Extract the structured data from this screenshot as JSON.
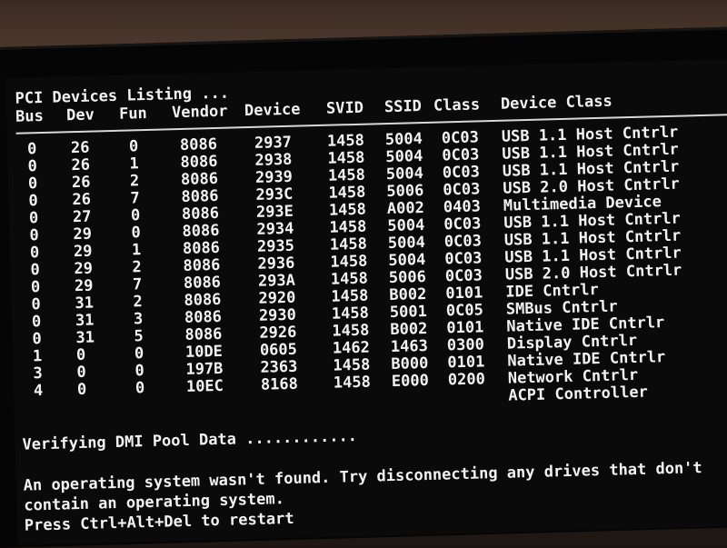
{
  "title": "PCI Devices Listing ...",
  "headers": {
    "bus": "Bus",
    "dev": "Dev",
    "fun": "Fun",
    "vendor": "Vendor",
    "device": "Device",
    "svid": "SVID",
    "ssid": "SSID",
    "class": "Class",
    "device_class": "Device Class"
  },
  "rows": [
    {
      "bus": "0",
      "dev": "26",
      "fun": "0",
      "vendor": "8086",
      "device": "2937",
      "svid": "1458",
      "ssid": "5004",
      "class": "0C03",
      "device_class": "USB 1.1 Host Cntrlr"
    },
    {
      "bus": "0",
      "dev": "26",
      "fun": "1",
      "vendor": "8086",
      "device": "2938",
      "svid": "1458",
      "ssid": "5004",
      "class": "0C03",
      "device_class": "USB 1.1 Host Cntrlr"
    },
    {
      "bus": "0",
      "dev": "26",
      "fun": "2",
      "vendor": "8086",
      "device": "2939",
      "svid": "1458",
      "ssid": "5004",
      "class": "0C03",
      "device_class": "USB 1.1 Host Cntrlr"
    },
    {
      "bus": "0",
      "dev": "26",
      "fun": "7",
      "vendor": "8086",
      "device": "293C",
      "svid": "1458",
      "ssid": "5006",
      "class": "0C03",
      "device_class": "USB 2.0 Host Cntrlr"
    },
    {
      "bus": "0",
      "dev": "27",
      "fun": "0",
      "vendor": "8086",
      "device": "293E",
      "svid": "1458",
      "ssid": "A002",
      "class": "0403",
      "device_class": "Multimedia Device"
    },
    {
      "bus": "0",
      "dev": "29",
      "fun": "0",
      "vendor": "8086",
      "device": "2934",
      "svid": "1458",
      "ssid": "5004",
      "class": "0C03",
      "device_class": "USB 1.1 Host Cntrlr"
    },
    {
      "bus": "0",
      "dev": "29",
      "fun": "1",
      "vendor": "8086",
      "device": "2935",
      "svid": "1458",
      "ssid": "5004",
      "class": "0C03",
      "device_class": "USB 1.1 Host Cntrlr"
    },
    {
      "bus": "0",
      "dev": "29",
      "fun": "2",
      "vendor": "8086",
      "device": "2936",
      "svid": "1458",
      "ssid": "5004",
      "class": "0C03",
      "device_class": "USB 1.1 Host Cntrlr"
    },
    {
      "bus": "0",
      "dev": "29",
      "fun": "7",
      "vendor": "8086",
      "device": "293A",
      "svid": "1458",
      "ssid": "5006",
      "class": "0C03",
      "device_class": "USB 2.0 Host Cntrlr"
    },
    {
      "bus": "0",
      "dev": "31",
      "fun": "2",
      "vendor": "8086",
      "device": "2920",
      "svid": "1458",
      "ssid": "B002",
      "class": "0101",
      "device_class": "IDE Cntrlr"
    },
    {
      "bus": "0",
      "dev": "31",
      "fun": "3",
      "vendor": "8086",
      "device": "2930",
      "svid": "1458",
      "ssid": "5001",
      "class": "0C05",
      "device_class": "SMBus Cntrlr"
    },
    {
      "bus": "0",
      "dev": "31",
      "fun": "5",
      "vendor": "8086",
      "device": "2926",
      "svid": "1458",
      "ssid": "B002",
      "class": "0101",
      "device_class": "Native IDE Cntrlr"
    },
    {
      "bus": "1",
      "dev": "0",
      "fun": "0",
      "vendor": "10DE",
      "device": "0605",
      "svid": "1462",
      "ssid": "1463",
      "class": "0300",
      "device_class": "Display Cntrlr"
    },
    {
      "bus": "3",
      "dev": "0",
      "fun": "0",
      "vendor": "197B",
      "device": "2363",
      "svid": "1458",
      "ssid": "B000",
      "class": "0101",
      "device_class": "Native IDE Cntrlr"
    },
    {
      "bus": "4",
      "dev": "0",
      "fun": "0",
      "vendor": "10EC",
      "device": "8168",
      "svid": "1458",
      "ssid": "E000",
      "class": "0200",
      "device_class": "Network Cntrlr"
    },
    {
      "bus": "",
      "dev": "",
      "fun": "",
      "vendor": "",
      "device": "",
      "svid": "",
      "ssid": "",
      "class": "",
      "device_class": "ACPI Controller"
    }
  ],
  "verify_text": "Verifying DMI Pool Data ............",
  "error_line_1": "An operating system wasn't found. Try disconnecting any drives that don't",
  "error_line_2": "contain an operating system.",
  "error_line_3": "Press Ctrl+Alt+Del to restart",
  "colors": {
    "screen_bg": "#0a0a0a",
    "text": "#f2f2f2"
  }
}
